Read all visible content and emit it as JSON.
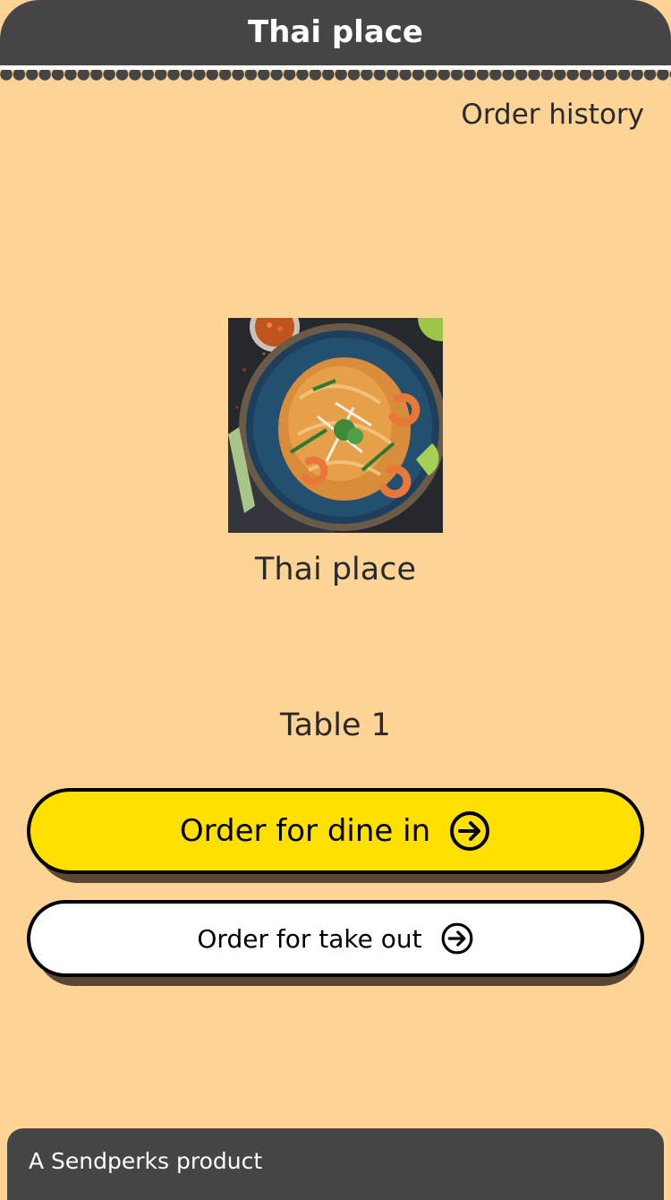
{
  "header": {
    "title": "Thai place"
  },
  "nav": {
    "order_history_label": "Order history"
  },
  "restaurant": {
    "name": "Thai place",
    "image_icon": "pad-thai-dish-photo"
  },
  "table": {
    "label": "Table 1"
  },
  "actions": {
    "dine_in_label": "Order for dine in",
    "take_out_label": "Order for take out",
    "arrow_icon": "arrow-right-circle-icon"
  },
  "footer": {
    "text": "A Sendperks product"
  },
  "colors": {
    "background": "#FDD396",
    "bar": "#454545",
    "dine_in_button": "#FFE000",
    "take_out_button": "#FFFFFF",
    "button_shadow": "#5A4632"
  }
}
